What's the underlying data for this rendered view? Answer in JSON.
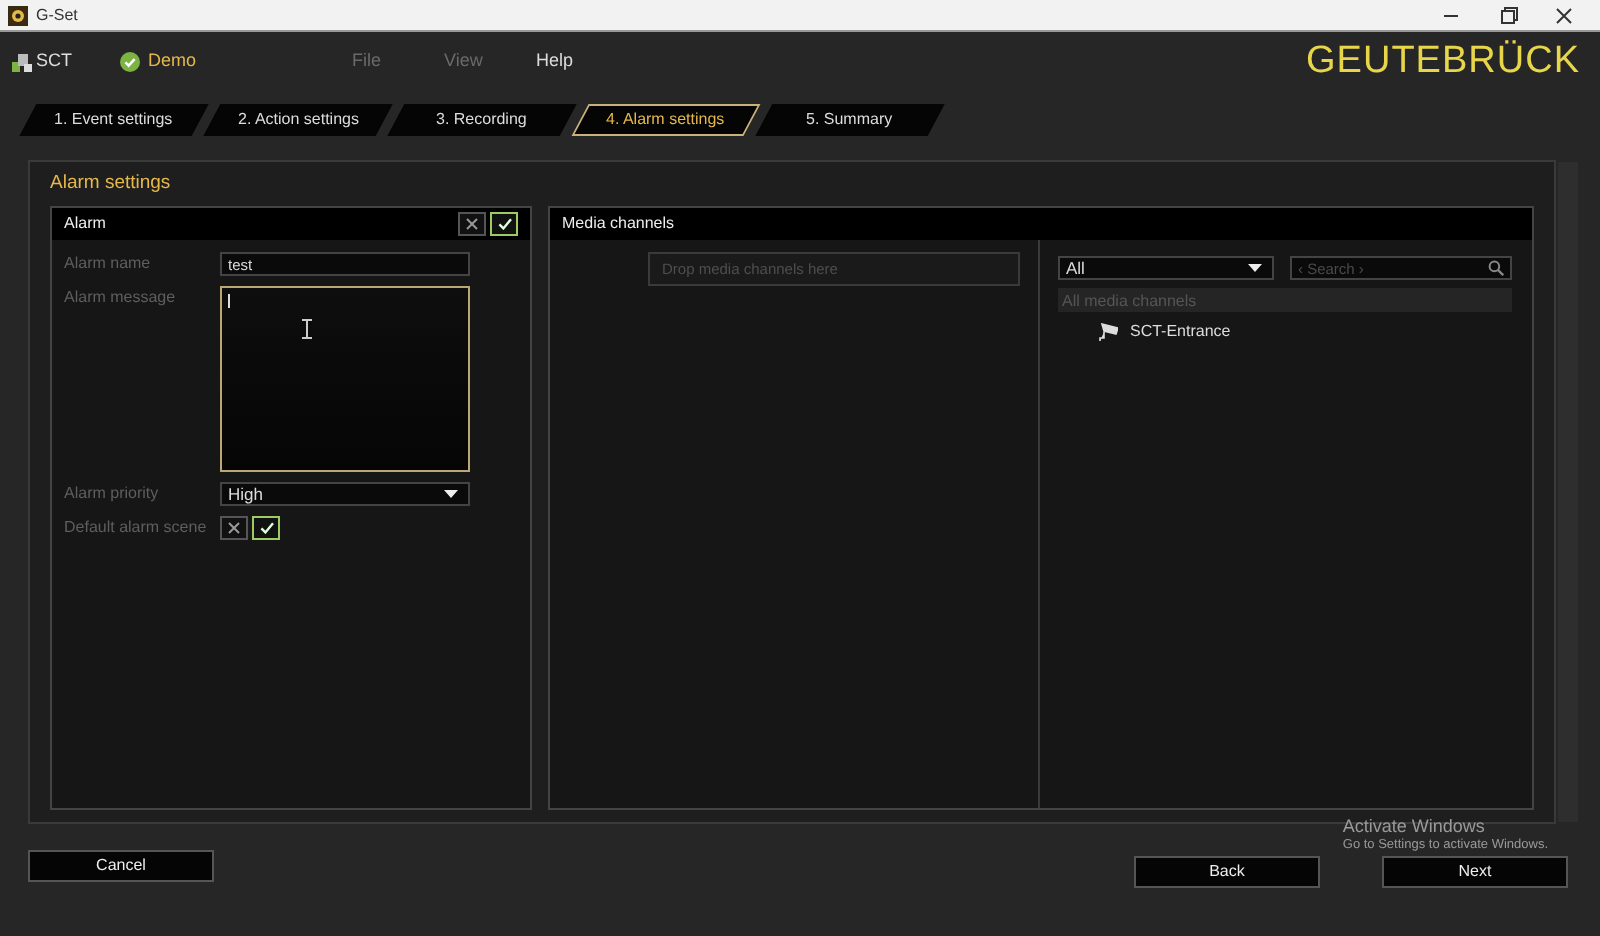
{
  "window": {
    "title": "G-Set"
  },
  "header": {
    "system": "SCT",
    "project": "Demo",
    "connected": true,
    "logo": "GEUTEBRÜCK",
    "menu": [
      {
        "label": "File",
        "disabled": true
      },
      {
        "label": "View",
        "disabled": true
      },
      {
        "label": "Help",
        "disabled": false
      }
    ]
  },
  "steps": [
    {
      "label": "1. Event settings",
      "selected": false
    },
    {
      "label": "2. Action settings",
      "selected": false
    },
    {
      "label": "3. Recording",
      "selected": false
    },
    {
      "label": "4. Alarm settings",
      "selected": true
    },
    {
      "label": "5. Summary",
      "selected": false
    }
  ],
  "section_title": "Alarm settings",
  "alarm": {
    "title": "Alarm",
    "on": true,
    "fields": [
      {
        "kind": "text",
        "label": "Alarm name",
        "value": "test"
      },
      {
        "kind": "textarea",
        "label": "Alarm message"
      },
      {
        "kind": "select",
        "label": "Alarm priority",
        "value": "High"
      },
      {
        "kind": "toggle",
        "label": "Default alarm scene",
        "on": true
      }
    ]
  },
  "media": {
    "title": "Media channels",
    "drop_placeholder": "Drop media channels here",
    "filter": "All",
    "search_placeholder": "‹ Search ›",
    "group": "All media channels",
    "channels": [
      {
        "name": "SCT-Entrance"
      }
    ]
  },
  "footer": {
    "cancel": "Cancel",
    "back": "Back",
    "next": "Next"
  },
  "os_notice": {
    "title": "Activate Windows",
    "text": "Go to Settings to activate Windows."
  }
}
